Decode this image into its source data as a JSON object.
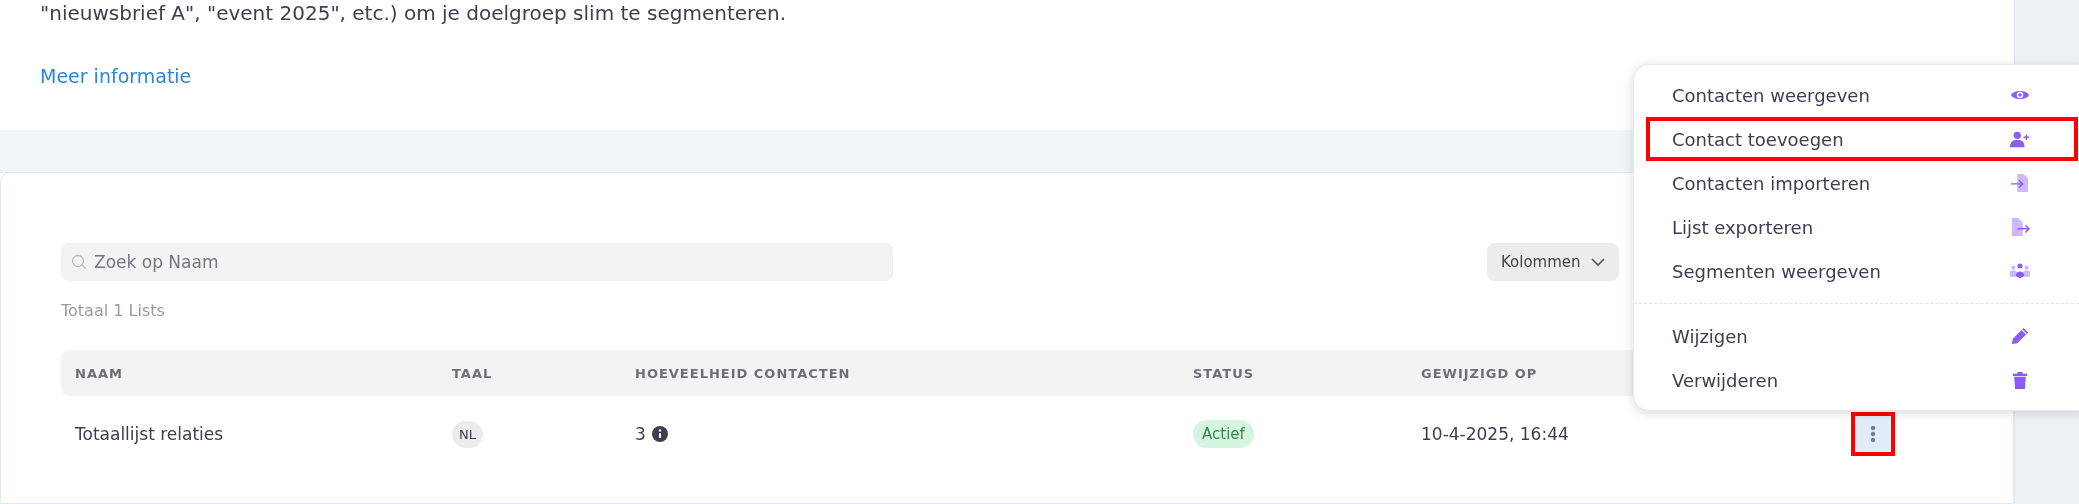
{
  "intro": {
    "text": "\"nieuwsbrief A\", \"event 2025\", etc.) om je doelgroep slim te segmenteren.",
    "link": "Meer informatie"
  },
  "search": {
    "placeholder": "Zoek op Naam"
  },
  "columns_button": {
    "label": "Kolommen"
  },
  "total": "Totaal 1 Lists",
  "table": {
    "columns": [
      "NAAM",
      "TAAL",
      "HOEVEELHEID CONTACTEN",
      "STATUS",
      "GEWIJZIGD OP"
    ],
    "rows": [
      {
        "name": "Totaallijst relaties",
        "language": "NL",
        "count": "3",
        "status": "Actief",
        "modified": "10-4-2025, 16:44",
        "menu_highlighted": true
      }
    ]
  },
  "menu": {
    "groups": [
      [
        {
          "label": "Contacten weergeven",
          "kind": "eye",
          "highlighted": false
        },
        {
          "label": "Contact toevoegen",
          "kind": "user-plus",
          "highlighted": true
        },
        {
          "label": "Contacten importeren",
          "kind": "import",
          "highlighted": false
        },
        {
          "label": "Lijst exporteren",
          "kind": "export",
          "highlighted": false
        },
        {
          "label": "Segmenten weergeven",
          "kind": "group",
          "highlighted": false
        }
      ],
      [
        {
          "label": "Wijzigen",
          "kind": "pencil",
          "highlighted": false
        },
        {
          "label": "Verwijderen",
          "kind": "trash",
          "highlighted": false
        }
      ]
    ]
  }
}
